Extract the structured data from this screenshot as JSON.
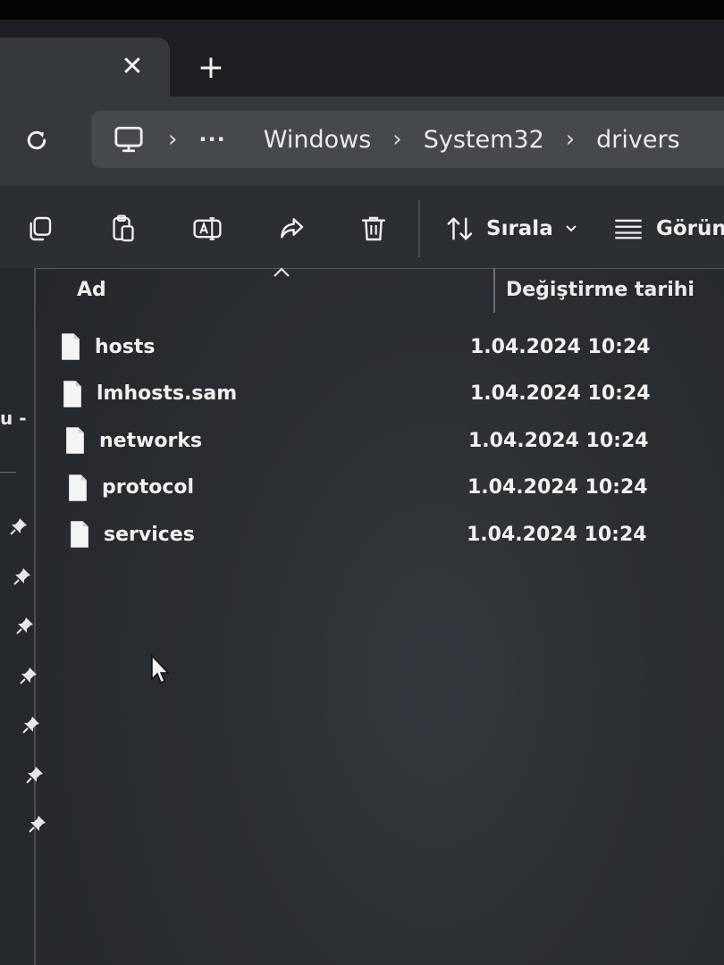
{
  "window": {
    "tab": {
      "close_glyph": "✕",
      "new_glyph": "+"
    },
    "colors": {
      "accent": "#35383c",
      "toolbar": "#2b2e32",
      "breadcrumb_bg": "#45494e"
    }
  },
  "address_bar": {
    "refresh_icon": "refresh-icon",
    "root_icon": "computer-icon",
    "separator": "›",
    "ellipsis": "···",
    "crumbs": [
      "Windows",
      "System32",
      "drivers"
    ]
  },
  "toolbar": {
    "icons": [
      "copy-icon",
      "paste-icon",
      "rename-icon",
      "share-icon",
      "delete-icon"
    ],
    "sort_label": "Sırala",
    "view_label": "Görünü"
  },
  "nav_pane": {
    "partial_label": "u -",
    "pinned_count": 7
  },
  "file_list": {
    "columns": {
      "name": "Ad",
      "date_modified": "Değiştirme tarihi"
    },
    "files": [
      {
        "name": "hosts",
        "date": "1.04.2024 10:24"
      },
      {
        "name": "lmhosts.sam",
        "date": "1.04.2024 10:24"
      },
      {
        "name": "networks",
        "date": "1.04.2024 10:24"
      },
      {
        "name": "protocol",
        "date": "1.04.2024 10:24"
      },
      {
        "name": "services",
        "date": "1.04.2024 10:24"
      }
    ]
  }
}
